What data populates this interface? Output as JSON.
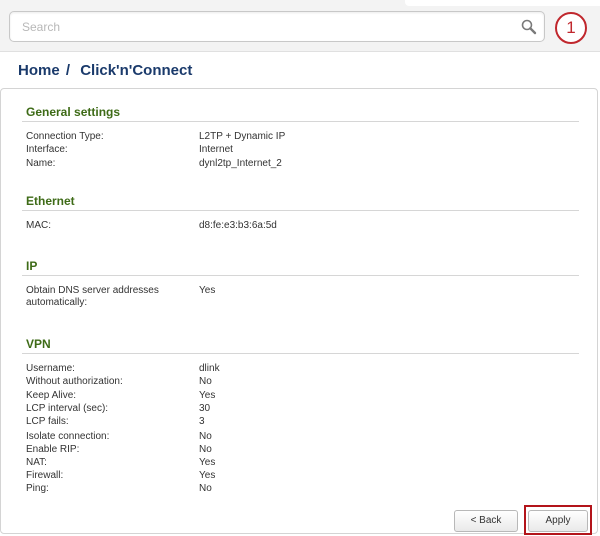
{
  "search": {
    "placeholder": "Search",
    "icon": "search-icon"
  },
  "step_marker": "1",
  "breadcrumb": {
    "home": "Home",
    "separator": "/",
    "current": "Click'n'Connect"
  },
  "sections": {
    "general": {
      "title": "General settings",
      "rows": [
        {
          "label": "Connection Type:",
          "value": "L2TP + Dynamic IP"
        },
        {
          "label": "Interface:",
          "value": "Internet"
        },
        {
          "label": "Name:",
          "value": "dynl2tp_Internet_2"
        }
      ]
    },
    "ethernet": {
      "title": "Ethernet",
      "rows": [
        {
          "label": "MAC:",
          "value": "d8:fe:e3:b3:6a:5d"
        }
      ]
    },
    "ip": {
      "title": "IP",
      "rows": [
        {
          "label_line1": "Obtain DNS server addresses",
          "label_line2": "automatically:",
          "value": "Yes"
        }
      ]
    },
    "vpn": {
      "title": "VPN",
      "rows": [
        {
          "label": "Username:",
          "value": "dlink"
        },
        {
          "label": "Without authorization:",
          "value": "No"
        },
        {
          "label": "Keep Alive:",
          "value": "Yes"
        },
        {
          "label": "LCP interval (sec):",
          "value": "30"
        },
        {
          "label": "LCP fails:",
          "value": "3"
        },
        {
          "label": "Isolate connection:",
          "value": "No"
        },
        {
          "label": "Enable RIP:",
          "value": "No"
        },
        {
          "label": "NAT:",
          "value": "Yes"
        },
        {
          "label": "Firewall:",
          "value": "Yes"
        },
        {
          "label": "Ping:",
          "value": "No"
        }
      ]
    }
  },
  "buttons": {
    "back": "< Back",
    "apply": "Apply"
  },
  "colors": {
    "section_title": "#3e6b17",
    "breadcrumb": "#1a3a6b",
    "highlight": "#b3141a"
  }
}
